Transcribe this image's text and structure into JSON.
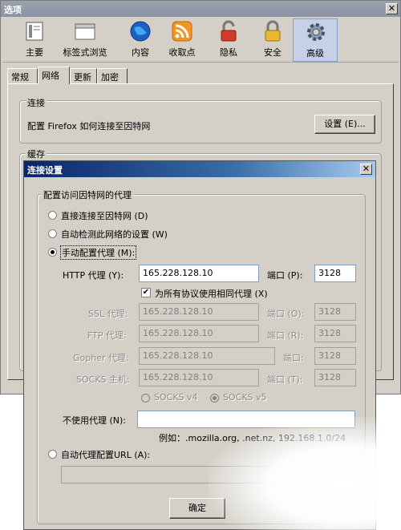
{
  "outer": {
    "title": "选项",
    "close": "✕",
    "toolbar": [
      {
        "label": "主要",
        "icon": "main-icon"
      },
      {
        "label": "标签式浏览",
        "icon": "tabs-icon"
      },
      {
        "label": "内容",
        "icon": "content-globe-icon"
      },
      {
        "label": "收取点",
        "icon": "feeds-icon"
      },
      {
        "label": "隐私",
        "icon": "privacy-lock-icon"
      },
      {
        "label": "安全",
        "icon": "security-lock-icon"
      },
      {
        "label": "高级",
        "icon": "advanced-gear-icon",
        "selected": true
      }
    ],
    "tabs": [
      "常规",
      "网络",
      "更新",
      "加密"
    ],
    "selected_tab": "网络",
    "connection": {
      "legend": "连接",
      "text": "配置 Firefox 如何连接至因特网",
      "settings_button": "设置 (E)..."
    },
    "cache": {
      "legend": "缓存"
    }
  },
  "dialog": {
    "title": "连接设置",
    "close": "✕",
    "group_legend": "配置访问因特网的代理",
    "direct": "直接连接至因特网 (D)",
    "auto_detect": "自动检测此网络的设置 (W)",
    "manual": "手动配置代理 (M):",
    "http_label": "HTTP 代理 (Y):",
    "http_value": "165.228.128.10",
    "port_label": "端口 (P):",
    "http_port": "3128",
    "same_proxy": "为所有协议使用相同代理 (X)",
    "ssl_label": "SSL 代理:",
    "ssl_value": "165.228.128.10",
    "ssl_port_label": "端口 (O):",
    "ssl_port": "3128",
    "ftp_label": "FTP 代理:",
    "ftp_value": "165.228.128.10",
    "ftp_port_label": "端口 (R):",
    "ftp_port": "3128",
    "gopher_label": "Gopher 代理:",
    "gopher_value": "165.228.128.10",
    "gopher_port_label": "端口:",
    "gopher_port": "3128",
    "socks_label": "SOCKS 主机:",
    "socks_value": "165.228.128.10",
    "socks_port_label": "端口 (T):",
    "socks_port": "3128",
    "socks_v4": "SOCKS v4",
    "socks_v5": "SOCKS v5",
    "no_proxy_label": "不使用代理 (N):",
    "no_proxy_value": "",
    "example": "例如：.mozilla.org, .net.nz, 192.168.1.0/24",
    "auto_url": "自动代理配置URL (A):",
    "auto_url_value": "",
    "ok": "确定"
  }
}
